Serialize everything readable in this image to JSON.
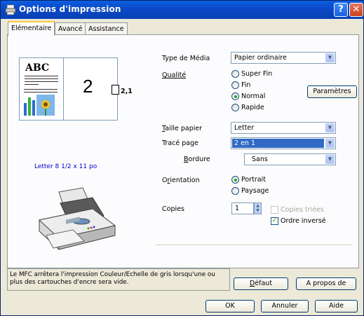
{
  "window": {
    "title": "Options d'impression",
    "help_btn": "?",
    "close_btn": "✕"
  },
  "tabs": [
    {
      "label": "Elémentaire",
      "active": true
    },
    {
      "label": "Avancé",
      "active": false
    },
    {
      "label": "Assistance",
      "active": false
    }
  ],
  "preview": {
    "abc": "ABC",
    "pages_count": "2",
    "pages_label": "2,1",
    "paper_info": "Letter 8 1/2 x 11 po"
  },
  "media_type": {
    "label": "Type de Média",
    "value": "Papier ordinaire"
  },
  "quality": {
    "label": "Qualité",
    "options": [
      "Super Fin",
      "Fin",
      "Normal",
      "Rapide"
    ],
    "selected": "Normal",
    "settings_button": "Paramètres"
  },
  "paper_size": {
    "label": "Taille papier",
    "value": "Letter"
  },
  "page_layout": {
    "label": "Tracé page",
    "value": "2 en 1"
  },
  "border": {
    "label": "Bordure",
    "value": "Sans"
  },
  "orientation": {
    "label": "Orientation",
    "options": [
      "Portrait",
      "Paysage"
    ],
    "selected": "Portrait"
  },
  "copies": {
    "label": "Copies",
    "value": "1",
    "collate": {
      "label": "Copies triées",
      "checked": false,
      "enabled": false
    },
    "reverse": {
      "label": "Ordre inversé",
      "checked": true,
      "enabled": true
    }
  },
  "info_message": "Le MFC arrêtera l'impression Couleur/Echelle de gris lorsqu'une ou plus des cartouches d'encre sera vide.",
  "buttons": {
    "default": "Défaut",
    "about": "A propos de",
    "ok": "OK",
    "cancel": "Annuler",
    "help": "Aide"
  },
  "colors": {
    "title_bar": "#0a48c6",
    "dialog_bg": "#ece9d8",
    "selection": "#316ac5",
    "link_text": "#0000c8"
  }
}
